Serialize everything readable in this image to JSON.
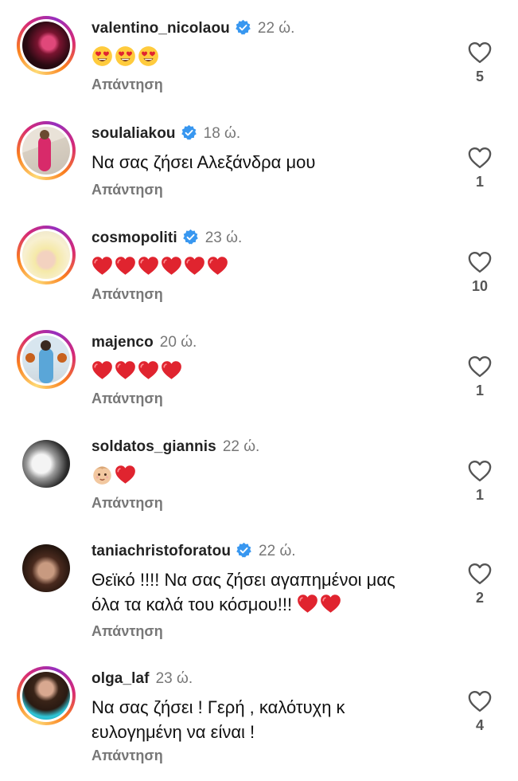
{
  "reply_label": "Απάντηση",
  "colors": {
    "heart": "#e0242f",
    "verified": "#3897f0",
    "ring": "#d62976"
  },
  "comments": [
    {
      "username": "valentino_nicolaou",
      "verified": true,
      "time": "22 ώ.",
      "text": "",
      "emojis": [
        "heart-eyes",
        "heart-eyes",
        "heart-eyes"
      ],
      "likes": "5"
    },
    {
      "username": "soulaliakou",
      "verified": true,
      "time": "18 ώ.",
      "text": "Να σας ζήσει Αλεξάνδρα μου",
      "emojis": [],
      "likes": "1"
    },
    {
      "username": "cosmopoliti",
      "verified": true,
      "time": "23 ώ.",
      "text": "",
      "emojis": [
        "heart",
        "heart",
        "heart",
        "heart",
        "heart",
        "heart"
      ],
      "likes": "10"
    },
    {
      "username": "majenco",
      "verified": false,
      "time": "20 ώ.",
      "text": "",
      "emojis": [
        "heart",
        "heart",
        "heart",
        "heart"
      ],
      "likes": "1"
    },
    {
      "username": "soldatos_giannis",
      "verified": false,
      "time": "22 ώ.",
      "text": "",
      "emojis": [
        "baby",
        "heart"
      ],
      "likes": "1"
    },
    {
      "username": "taniachristoforatou",
      "verified": true,
      "time": "22 ώ.",
      "text_line1": "Θεϊκό !!!! Να σας ζήσει αγαπημένοι μας",
      "text_line2": "όλα τα καλά του κόσμου!!!",
      "emojis": [
        "heart",
        "heart"
      ],
      "likes": "2"
    },
    {
      "username": "olga_laf",
      "verified": false,
      "time": "23 ώ.",
      "text_line1": "Να σας ζήσει ! Γερή , καλότυχη κ",
      "text_line2": "ευλογημένη να είναι !",
      "emojis": [],
      "likes": "4"
    }
  ]
}
